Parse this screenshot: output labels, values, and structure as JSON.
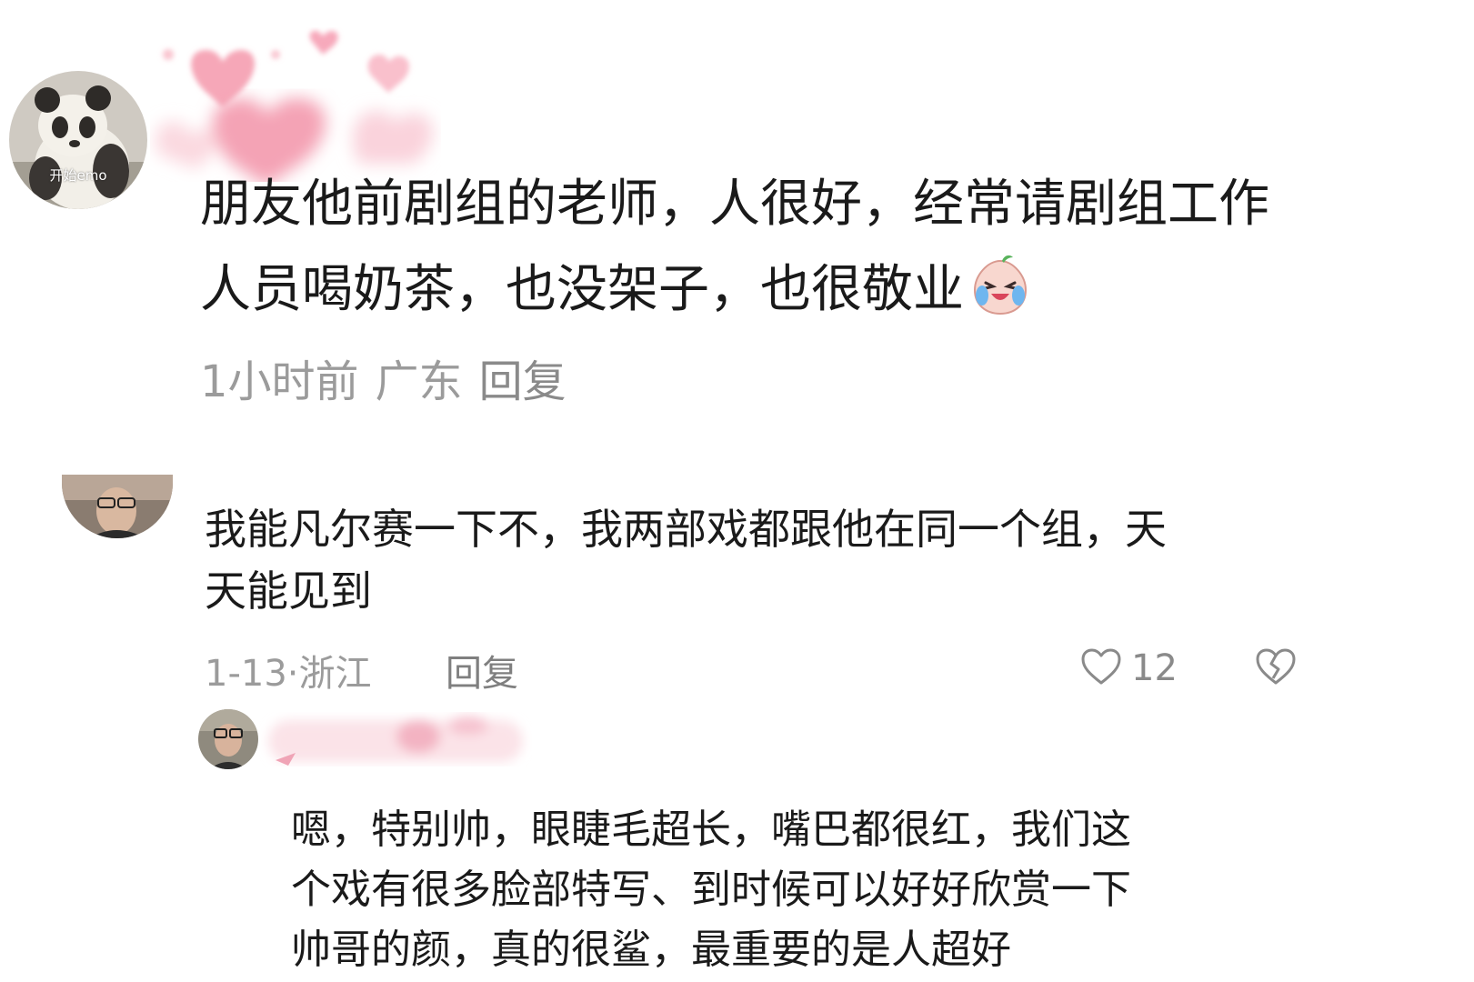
{
  "comments": [
    {
      "avatar": {
        "caption": "开始emo",
        "icon": "panda-avatar"
      },
      "text_lines": [
        "朋友他前剧组的老师，人很好，经常请剧组工作",
        "人员喝奶茶，也没架子，也很敬业"
      ],
      "emoji_icon": "crying-laughing-emoji",
      "time": "1小时前",
      "location": "广东",
      "reply_label": "回复"
    },
    {
      "avatar": {
        "icon": "user-photo-avatar"
      },
      "text_lines": [
        "我能凡尔赛一下不，我两部戏都跟他在同一个组，天",
        "天能见到"
      ],
      "time": "1-13·",
      "location": "浙江",
      "reply_label": "回复",
      "like_count": "12",
      "like_icon": "heart-outline-icon",
      "dislike_icon": "broken-heart-icon"
    },
    {
      "avatar": {
        "icon": "user-photo-avatar"
      },
      "text_lines": [
        "嗯，特别帅，眼睫毛超长，嘴巴都很红，我们这",
        "个戏有很多脸部特写、到时候可以好好欣赏一下",
        "帅哥的颜，真的很鲨，最重要的是人超好"
      ]
    }
  ],
  "colors": {
    "text": "#1a1a1a",
    "meta": "#9b9b9b",
    "decoration_pink": "#f7b8c6"
  }
}
